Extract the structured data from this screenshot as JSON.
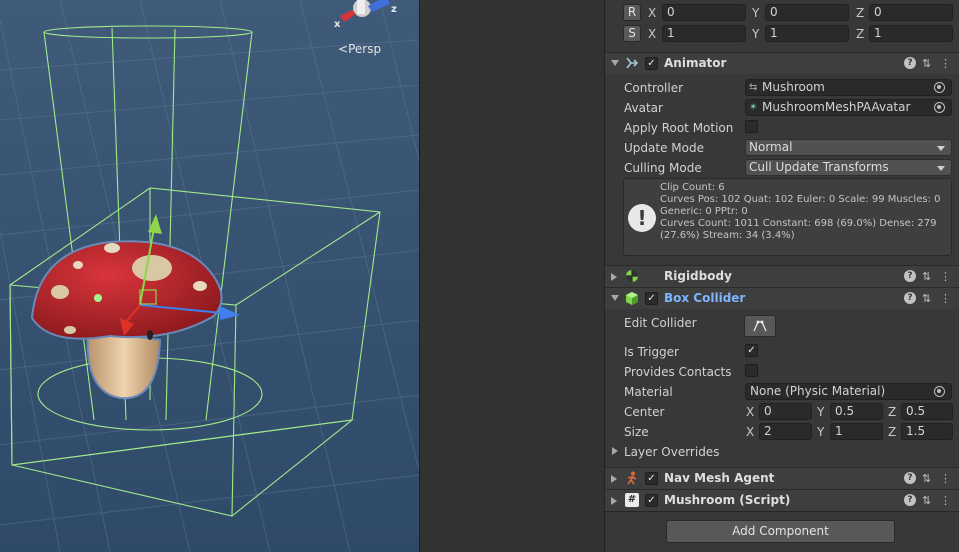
{
  "scene": {
    "persp_label": "Persp",
    "gizmo": {
      "x": "x",
      "z": "z"
    }
  },
  "transform": {
    "rotation": {
      "btn": "R",
      "x_label": "X",
      "x": "0",
      "y_label": "Y",
      "y": "0",
      "z_label": "Z",
      "z": "0"
    },
    "scale": {
      "btn": "S",
      "x_label": "X",
      "x": "1",
      "y_label": "Y",
      "y": "1",
      "z_label": "Z",
      "z": "1"
    }
  },
  "animator": {
    "title": "Animator",
    "icon": "animator-icon",
    "controller_label": "Controller",
    "controller_value": "Mushroom",
    "avatar_label": "Avatar",
    "avatar_value": "MushroomMeshPAAvatar",
    "apply_root_motion_label": "Apply Root Motion",
    "update_mode_label": "Update Mode",
    "update_mode_value": "Normal",
    "culling_mode_label": "Culling Mode",
    "culling_mode_value": "Cull Update Transforms",
    "info": {
      "line1": "Clip Count: 6",
      "line2": "Curves Pos: 102 Quat: 102 Euler: 0 Scale: 99 Muscles: 0",
      "line3": "Generic: 0 PPtr: 0",
      "line4": "Curves Count: 1011 Constant: 698 (69.0%) Dense: 279",
      "line5": "(27.6%) Stream: 34 (3.4%)"
    }
  },
  "rigidbody": {
    "title": "Rigidbody",
    "icon": "rigidbody-icon"
  },
  "box_collider": {
    "title": "Box Collider",
    "icon": "box-collider-icon",
    "edit_collider_label": "Edit Collider",
    "is_trigger_label": "Is Trigger",
    "is_trigger": true,
    "provides_contacts_label": "Provides Contacts",
    "material_label": "Material",
    "material_value": "None (Physic Material)",
    "center_label": "Center",
    "center": {
      "x": "0",
      "y": "0.5",
      "z": "0.5"
    },
    "size_label": "Size",
    "size": {
      "x": "2",
      "y": "1",
      "z": "1.5"
    },
    "layer_overrides_label": "Layer Overrides",
    "axis": {
      "x": "X",
      "y": "Y",
      "z": "Z"
    }
  },
  "nav_mesh_agent": {
    "title": "Nav Mesh Agent",
    "icon": "nav-mesh-agent-icon"
  },
  "mushroom_script": {
    "title": "Mushroom (Script)",
    "icon": "script-icon"
  },
  "add_component_label": "Add Component",
  "colors": {
    "scene_bg": "#3d5876",
    "panel_bg": "#383838",
    "header_bg": "#3e3e3e",
    "collider_green": "#a6f28c",
    "mushroom_red": "#b8252b",
    "accent_title": "#7eb6ff"
  }
}
